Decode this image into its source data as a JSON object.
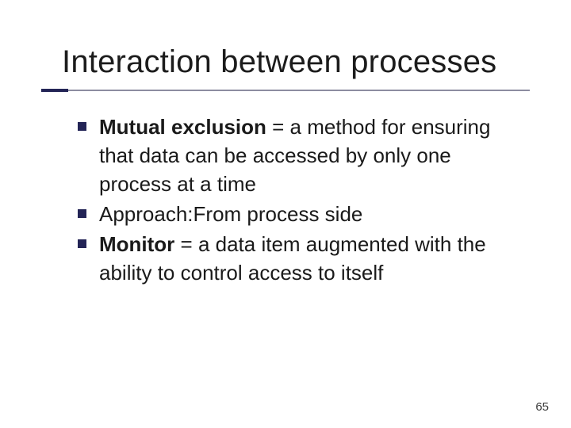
{
  "slide": {
    "title": "Interaction between processes",
    "page_number": "65"
  },
  "bullets": [
    {
      "bold": "Mutual exclusion",
      "rest": " = a method for ensuring that data can be accessed by only one process at a time"
    },
    {
      "bold": "",
      "rest": "Approach:From process side"
    },
    {
      "bold": "Monitor",
      "rest": " = a data item augmented with the ability to control access to itself"
    }
  ]
}
